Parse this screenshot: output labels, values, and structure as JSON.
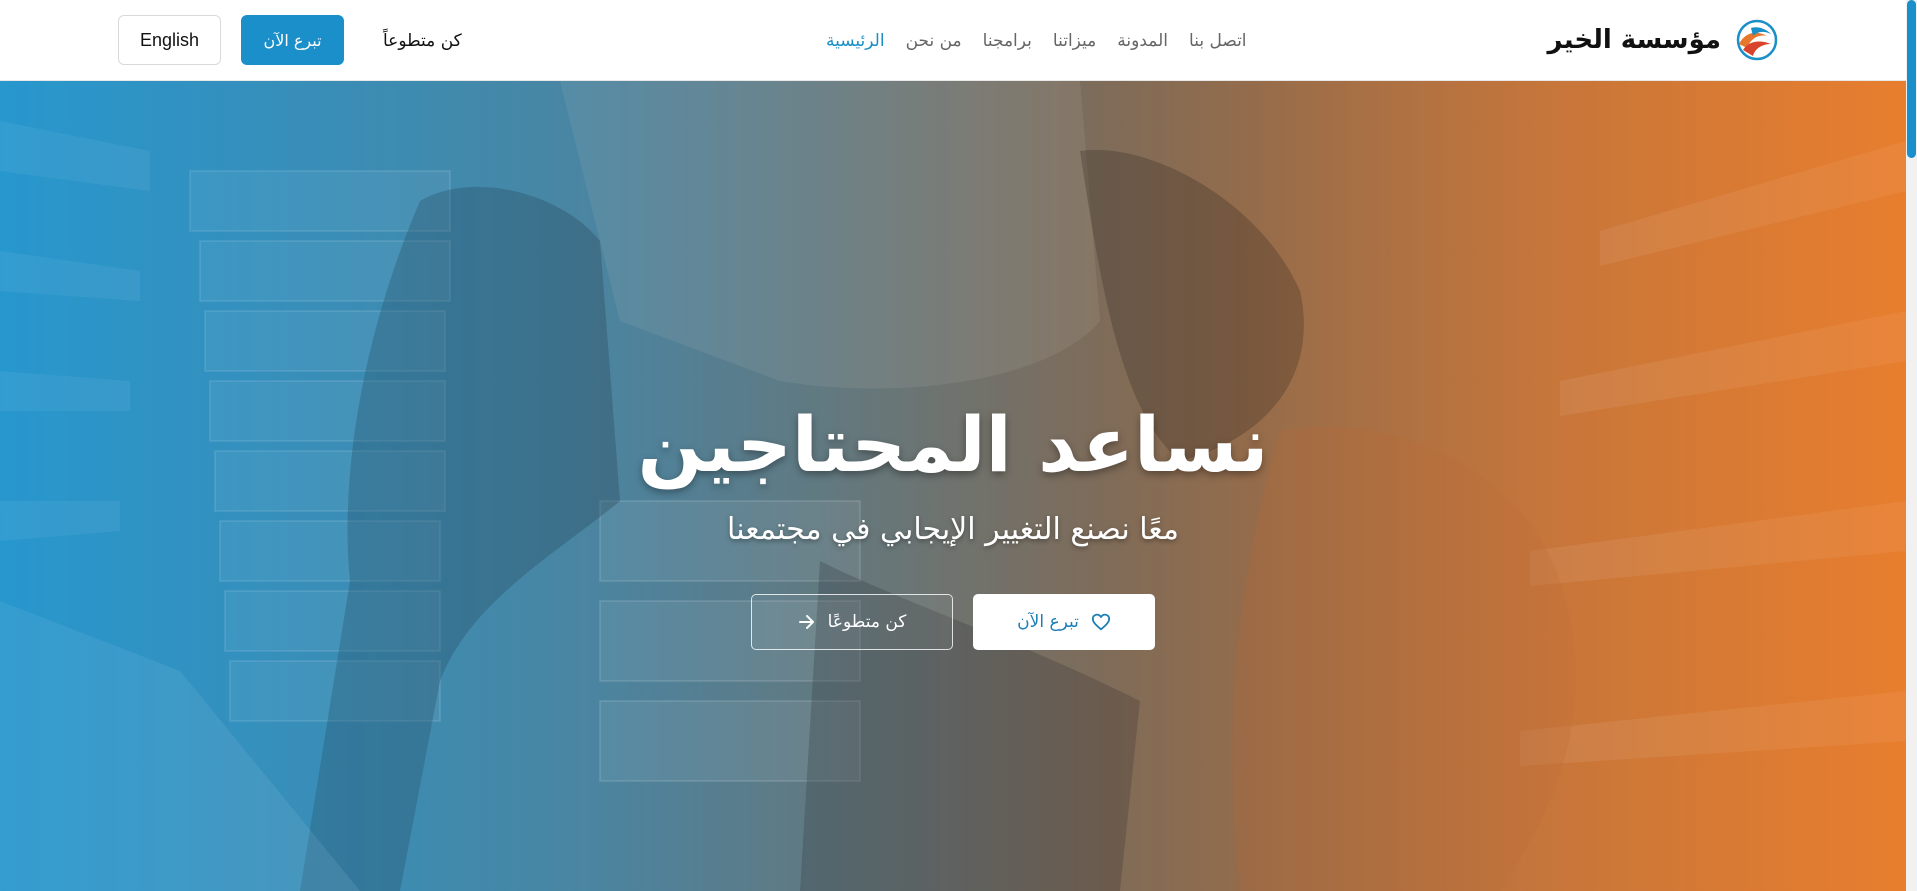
{
  "header": {
    "brand_name": "مؤسسة الخير",
    "nav": [
      {
        "label": "الرئيسية",
        "active": true
      },
      {
        "label": "من نحن",
        "active": false
      },
      {
        "label": "برامجنا",
        "active": false
      },
      {
        "label": "ميزاتنا",
        "active": false
      },
      {
        "label": "المدونة",
        "active": false
      },
      {
        "label": "اتصل بنا",
        "active": false
      }
    ],
    "volunteer_label": "كن متطوعاً",
    "donate_label": "تبرع الآن",
    "language_label": "English"
  },
  "hero": {
    "title": "نساعد المحتاجين",
    "subtitle": "معًا نصنع التغيير الإيجابي في مجتمعنا",
    "donate_label": "تبرع الآن",
    "volunteer_label": "كن متطوعًا"
  },
  "icons": {
    "brand": "hands-heart-logo-icon",
    "donate": "heart-icon",
    "volunteer": "arrow-right-icon"
  },
  "colors": {
    "accent": "#1b8fc9",
    "nav_active": "#1a8ec8",
    "hero_gradient_left": "#2f98c8",
    "hero_gradient_right": "#e27f30"
  }
}
